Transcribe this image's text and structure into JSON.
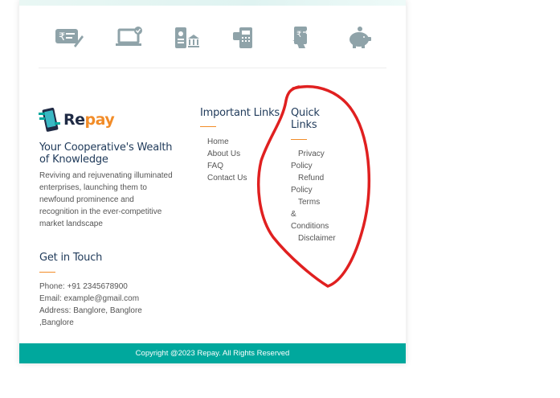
{
  "brand": {
    "logo_text_re": "Re",
    "logo_text_pay": "pay",
    "colors": {
      "teal": "#00a89d",
      "orange": "#f28c28",
      "icon": "#8fa3a9",
      "annotation": "#e02020"
    }
  },
  "feature_icons": [
    "rupee-card-icon",
    "laptop-payment-icon",
    "mobile-bank-icon",
    "atm-card-icon",
    "mobile-pay-hand-icon",
    "piggy-bank-icon"
  ],
  "about": {
    "title": "Your Cooperative's Wealth of Knowledge",
    "lines": [
      "Reviving and rejuvenating illuminated",
      "enterprises, launching them to",
      "newfound prominence and",
      "recognition in the ever-competitive",
      "market landscape"
    ]
  },
  "important_links": {
    "title": "Important Links",
    "items": [
      "Home",
      "About Us",
      "FAQ",
      "Contact Us"
    ]
  },
  "quick_links": {
    "title_line1": "Quick",
    "title_line2": "Links",
    "items": [
      {
        "first": "Privacy",
        "rest": [
          "Policy"
        ]
      },
      {
        "first": "Refund",
        "rest": [
          "Policy"
        ]
      },
      {
        "first": "Terms",
        "rest": [
          "&",
          "Conditions"
        ]
      },
      {
        "first": "Disclaimer",
        "rest": []
      }
    ]
  },
  "contact": {
    "title": "Get in Touch",
    "phone": "Phone: +91 2345678900",
    "email": "Email: example@gmail.com",
    "address_line1": "Address: Banglore, Banglore",
    "address_line2": ",Banglore"
  },
  "footer": {
    "copyright": "Copyright @2023 Repay. All Rights Reserved"
  }
}
